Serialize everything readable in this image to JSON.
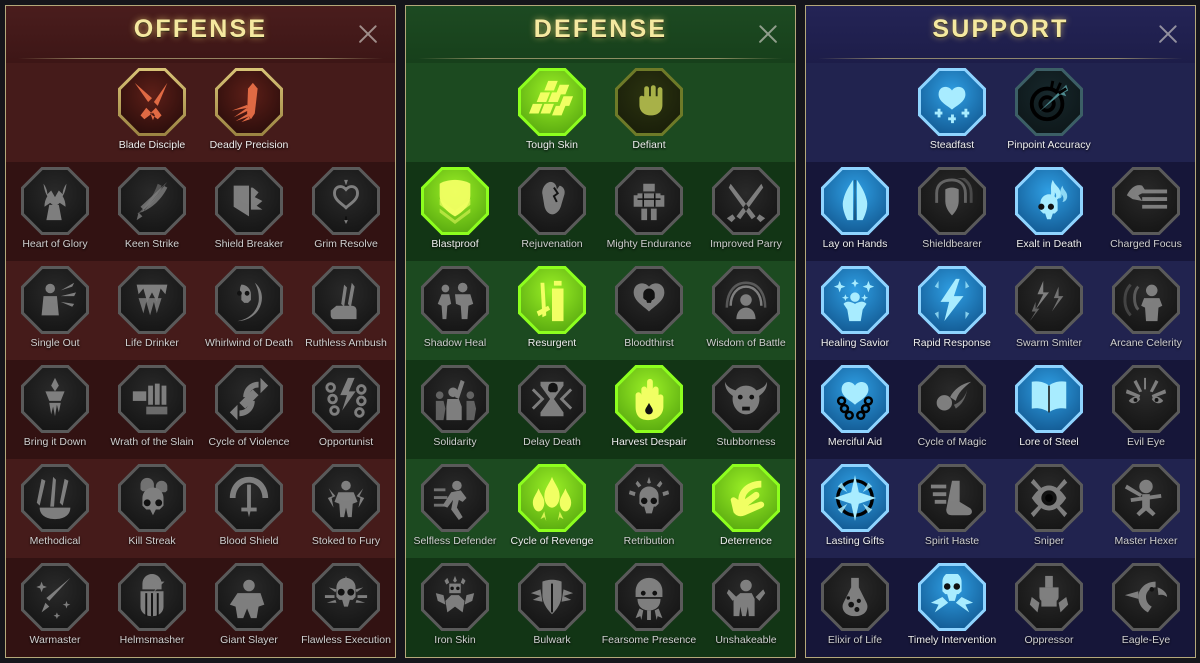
{
  "panels": [
    {
      "id": "offense",
      "title": "OFFENSE",
      "close_label": "close-icon",
      "accent": "#b4a87a",
      "background": "#3b1616",
      "rows": [
        {
          "shade": "shade",
          "nodes": [
            {
              "label": "Blade Disciple",
              "state": "act-off",
              "icon": "crossed-swords"
            },
            {
              "label": "Deadly Precision",
              "state": "act-off",
              "icon": "dagger-burst"
            }
          ]
        },
        {
          "shade": "dark",
          "nodes": [
            {
              "label": "Heart of Glory",
              "state": "locked",
              "icon": "horned-figure-heart"
            },
            {
              "label": "Keen Strike",
              "state": "locked",
              "icon": "slashing-sword"
            },
            {
              "label": "Shield Breaker",
              "state": "locked",
              "icon": "broken-shield"
            },
            {
              "label": "Grim Resolve",
              "state": "locked",
              "icon": "pierced-heart"
            }
          ]
        },
        {
          "shade": "shade",
          "nodes": [
            {
              "label": "Single Out",
              "state": "locked",
              "icon": "targeted-soldier"
            },
            {
              "label": "Life Drinker",
              "state": "locked",
              "icon": "fanged-maw"
            },
            {
              "label": "Whirlwind of Death",
              "state": "locked",
              "icon": "skull-whirlwind"
            },
            {
              "label": "Ruthless Ambush",
              "state": "locked",
              "icon": "hand-dagger"
            }
          ]
        },
        {
          "shade": "dark",
          "nodes": [
            {
              "label": "Bring it Down",
              "state": "locked",
              "icon": "dripping-blade"
            },
            {
              "label": "Wrath of the Slain",
              "state": "locked",
              "icon": "skeleton-fist"
            },
            {
              "label": "Cycle of Violence",
              "state": "locked",
              "icon": "cycling-axe"
            },
            {
              "label": "Opportunist",
              "state": "locked",
              "icon": "chain-lightning"
            }
          ]
        },
        {
          "shade": "shade",
          "nodes": [
            {
              "label": "Methodical",
              "state": "locked",
              "icon": "arrow-cluster"
            },
            {
              "label": "Kill Streak",
              "state": "locked",
              "icon": "triple-skull"
            },
            {
              "label": "Blood Shield",
              "state": "locked",
              "icon": "sword-crescent"
            },
            {
              "label": "Stoked to Fury",
              "state": "locked",
              "icon": "raging-figure"
            }
          ]
        },
        {
          "shade": "dark",
          "nodes": [
            {
              "label": "Warmaster",
              "state": "locked",
              "icon": "starlit-sword"
            },
            {
              "label": "Helmsmasher",
              "state": "locked",
              "icon": "cracked-helm"
            },
            {
              "label": "Giant Slayer",
              "state": "locked",
              "icon": "giant-silhouette"
            },
            {
              "label": "Flawless Execution",
              "state": "locked",
              "icon": "radiant-skull"
            }
          ]
        }
      ]
    },
    {
      "id": "defense",
      "title": "DEFENSE",
      "close_label": "close-icon",
      "accent": "#b4a87a",
      "background": "#16401a",
      "rows": [
        {
          "shade": "shade",
          "nodes": [
            {
              "label": "Tough Skin",
              "state": "act-def",
              "icon": "scale-plates"
            },
            {
              "label": "Defiant",
              "state": "dim-def",
              "icon": "raised-fist"
            }
          ]
        },
        {
          "shade": "dark",
          "nodes": [
            {
              "label": "Blastproof",
              "state": "act-def",
              "icon": "layered-shield"
            },
            {
              "label": "Rejuvenation",
              "state": "locked",
              "icon": "heart-organ"
            },
            {
              "label": "Mighty Endurance",
              "state": "locked",
              "icon": "stone-golem"
            },
            {
              "label": "Improved Parry",
              "state": "locked",
              "icon": "crossed-blades"
            }
          ]
        },
        {
          "shade": "shade",
          "nodes": [
            {
              "label": "Shadow Heal",
              "state": "locked",
              "icon": "shadow-figures"
            },
            {
              "label": "Resurgent",
              "state": "act-def",
              "icon": "standing-warrior"
            },
            {
              "label": "Bloodthirst",
              "state": "locked",
              "icon": "skull-heart"
            },
            {
              "label": "Wisdom of Battle",
              "state": "locked",
              "icon": "aura-head"
            }
          ]
        },
        {
          "shade": "dark",
          "nodes": [
            {
              "label": "Solidarity",
              "state": "locked",
              "icon": "crowd-raised-arm"
            },
            {
              "label": "Delay Death",
              "state": "locked",
              "icon": "hourglass-skull"
            },
            {
              "label": "Harvest Despair",
              "state": "act-def",
              "icon": "open-palm-drop"
            },
            {
              "label": "Stubborness",
              "state": "locked",
              "icon": "bull-head"
            }
          ]
        },
        {
          "shade": "shade",
          "nodes": [
            {
              "label": "Selfless Defender",
              "state": "locked",
              "icon": "running-figure"
            },
            {
              "label": "Cycle of Revenge",
              "state": "act-def",
              "icon": "triple-flame"
            },
            {
              "label": "Retribution",
              "state": "locked",
              "icon": "spiked-skull"
            },
            {
              "label": "Deterrence",
              "state": "act-def",
              "icon": "blocking-hand"
            }
          ]
        },
        {
          "shade": "dark",
          "nodes": [
            {
              "label": "Iron Skin",
              "state": "locked",
              "icon": "spiked-guardian"
            },
            {
              "label": "Bulwark",
              "state": "locked",
              "icon": "winged-shield"
            },
            {
              "label": "Fearsome Presence",
              "state": "locked",
              "icon": "roaring-face"
            },
            {
              "label": "Unshakeable",
              "state": "locked",
              "icon": "braced-figure"
            }
          ]
        }
      ]
    },
    {
      "id": "support",
      "title": "SUPPORT",
      "close_label": "close-icon",
      "accent": "#b4a87a",
      "background": "#1b1b45",
      "rows": [
        {
          "shade": "shade",
          "nodes": [
            {
              "label": "Steadfast",
              "state": "act-sup",
              "icon": "heart-plus"
            },
            {
              "label": "Pinpoint Accuracy",
              "state": "dim-sup",
              "icon": "target-arrow"
            }
          ]
        },
        {
          "shade": "dark",
          "nodes": [
            {
              "label": "Lay on Hands",
              "state": "act-sup",
              "icon": "praying-hands"
            },
            {
              "label": "Shieldbearer",
              "state": "locked",
              "icon": "aura-shield"
            },
            {
              "label": "Exalt in Death",
              "state": "act-sup",
              "icon": "flaming-skull"
            },
            {
              "label": "Charged Focus",
              "state": "locked",
              "icon": "arm-beam"
            }
          ]
        },
        {
          "shade": "shade",
          "nodes": [
            {
              "label": "Healing Savior",
              "state": "act-sup",
              "icon": "blessed-figure"
            },
            {
              "label": "Rapid Response",
              "state": "act-sup",
              "icon": "lightning-bolt"
            },
            {
              "label": "Swarm Smiter",
              "state": "locked",
              "icon": "swarm-bolts"
            },
            {
              "label": "Arcane Celerity",
              "state": "locked",
              "icon": "blurred-figure"
            }
          ]
        },
        {
          "shade": "dark",
          "nodes": [
            {
              "label": "Merciful Aid",
              "state": "act-sup",
              "icon": "chained-heart"
            },
            {
              "label": "Cycle of Magic",
              "state": "locked",
              "icon": "comet-swirl"
            },
            {
              "label": "Lore of Steel",
              "state": "act-sup",
              "icon": "open-book"
            },
            {
              "label": "Evil Eye",
              "state": "locked",
              "icon": "angry-eyes"
            }
          ]
        },
        {
          "shade": "shade",
          "nodes": [
            {
              "label": "Lasting Gifts",
              "state": "act-sup",
              "icon": "radiant-star"
            },
            {
              "label": "Spirit Haste",
              "state": "locked",
              "icon": "winged-boot"
            },
            {
              "label": "Sniper",
              "state": "locked",
              "icon": "eye-scope"
            },
            {
              "label": "Master Hexer",
              "state": "locked",
              "icon": "voodoo-doll"
            }
          ]
        },
        {
          "shade": "dark",
          "nodes": [
            {
              "label": "Elixir of Life",
              "state": "locked",
              "icon": "potion-flask"
            },
            {
              "label": "Timely Intervention",
              "state": "act-sup",
              "icon": "winged-skull"
            },
            {
              "label": "Oppressor",
              "state": "locked",
              "icon": "crushing-fist"
            },
            {
              "label": "Eagle-Eye",
              "state": "locked",
              "icon": "eagle-head"
            }
          ]
        }
      ]
    }
  ]
}
